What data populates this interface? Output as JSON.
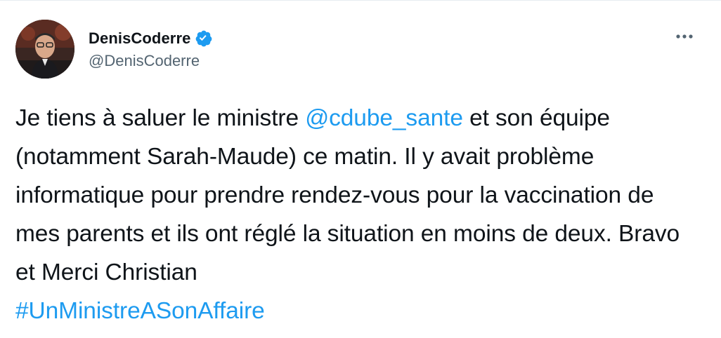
{
  "user": {
    "display_name": "DenisCoderre",
    "handle": "@DenisCoderre",
    "verified_icon": "verified-badge-icon",
    "avatar_icon": "avatar-photo"
  },
  "menu": {
    "icon": "more-options-icon"
  },
  "tweet": {
    "segment_1": "Je tiens à saluer le ministre ",
    "mention": "@cdube_sante",
    "segment_2": " et son équipe (notamment Sarah-Maude) ce matin. Il y avait problème informatique pour prendre rendez-vous pour la vaccination de mes parents et ils ont réglé la situation en moins de deux. Bravo et Merci Christian",
    "hashtag": "#UnMinistreASonAffaire"
  },
  "colors": {
    "link": "#1d9bf0",
    "text": "#0f1419",
    "secondary": "#536471"
  }
}
